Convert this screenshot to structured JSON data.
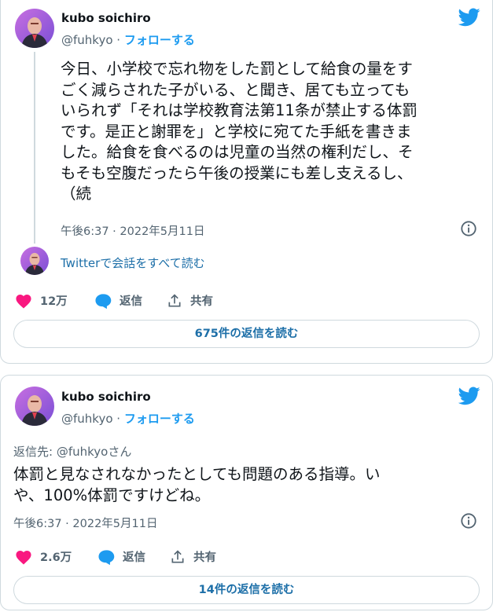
{
  "colors": {
    "accent": "#1d9bf0",
    "like": "#f91880",
    "muted": "#536471",
    "border": "#cfd9de"
  },
  "icons": [
    "avatar-image",
    "twitter-bird-icon",
    "info-icon",
    "heart-icon",
    "reply-bubble-icon",
    "share-upload-icon"
  ],
  "tweet1": {
    "author_name": "kubo soichiro",
    "handle": "@fuhkyo",
    "separator": " · ",
    "follow_label": "フォローする",
    "text_lines": [
      "今日、小学校で忘れ物をした罰として給食の量をす",
      "ごく減らされた子がいる、と聞き、居ても立っても",
      "いられず「それは学校教育法第11条が禁止する体罰",
      "です。是正と謝罪を」と学校に宛てた手紙を書きま",
      "した。給食を食べるのは児童の当然の権利だし、そ",
      "もそも空腹だったら午後の授業にも差し支えるし、",
      "（続"
    ],
    "timestamp": "午後6:37 · 2022年5月11日",
    "read_conversation": "Twitterで会話をすべて読む",
    "likes": "12万",
    "reply_label": "返信",
    "share_label": "共有",
    "read_replies": "675件の返信を読む"
  },
  "tweet2": {
    "author_name": "kubo soichiro",
    "handle": "@fuhkyo",
    "separator": " · ",
    "follow_label": "フォローする",
    "reply_to": "返信先: @fuhkyoさん",
    "text_lines": [
      "体罰と見なされなかったとしても問題のある指導。い",
      "や、100%体罰ですけどね。"
    ],
    "timestamp": "午後6:37 · 2022年5月11日",
    "likes": "2.6万",
    "reply_label": "返信",
    "share_label": "共有",
    "read_replies": "14件の返信を読む"
  }
}
